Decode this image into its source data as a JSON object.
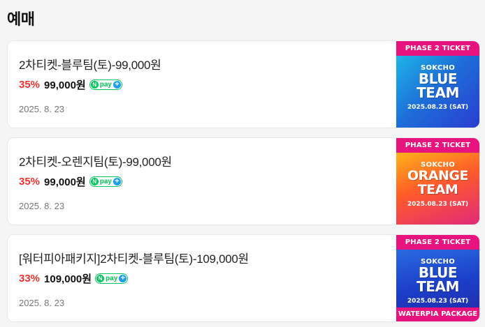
{
  "section": {
    "title": "예매"
  },
  "items": [
    {
      "title": "2차티켓-블루팀(토)-99,000원",
      "discount": "35%",
      "price": "99,000원",
      "npay": "pay",
      "date": "2025. 8. 23",
      "thumb": {
        "banner": "PHASE 2 TICKET",
        "small": "SOKCHO",
        "line1": "BLUE",
        "line2": "TEAM",
        "date": "2025.08.23 (SAT)",
        "colors": [
          "#1fb5e8",
          "#2a3dd0"
        ]
      }
    },
    {
      "title": "2차티켓-오렌지팀(토)-99,000원",
      "discount": "35%",
      "price": "99,000원",
      "npay": "pay",
      "date": "2025. 8. 23",
      "thumb": {
        "banner": "PHASE 2 TICKET",
        "small": "SOKCHO",
        "line1": "ORANGE",
        "line2": "TEAM",
        "date": "2025.08.23 (SAT)",
        "colors": [
          "#ffb21a",
          "#e02a7a"
        ]
      }
    },
    {
      "title": "[워터피아패키지]2차티켓-블루팀(토)-109,000원",
      "discount": "33%",
      "price": "109,000원",
      "npay": "pay",
      "date": "2025. 8. 23",
      "thumb": {
        "banner": "PHASE 2 TICKET",
        "small": "SOKCHO",
        "line1": "BLUE",
        "line2": "TEAM",
        "date": "2025.08.23 (SAT)",
        "footer": "WATERPIA PACKAGE",
        "colors": [
          "#2a6ae0",
          "#2230b0"
        ]
      }
    }
  ],
  "icons": {
    "npay_logo": "naver-pay-plus-icon"
  },
  "colors": {
    "discount": "#f2322f",
    "npay_green": "#03c75a",
    "banner_pink": "#e8137e"
  }
}
